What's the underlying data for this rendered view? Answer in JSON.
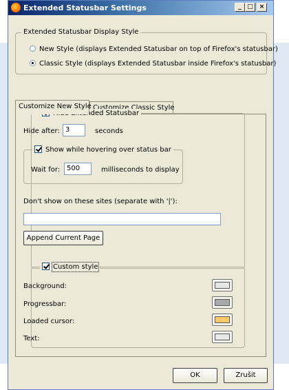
{
  "window": {
    "title": "Extended Statusbar Settings",
    "minimize": "_",
    "maximize": "□",
    "close": "×"
  },
  "display_style": {
    "legend": "Extended Statusbar Display Style",
    "new_style": {
      "label": "New Style (displays Extended Statusbar on top of Firefox's statusbar)",
      "selected": false
    },
    "classic_style": {
      "label": "Classic Style (displays Extended Statusbar inside Firefox's statusbar)",
      "selected": true
    }
  },
  "tabs": [
    {
      "label": "Customize New Style",
      "active": true
    },
    {
      "label": "Customize Classic Style",
      "active": false
    }
  ],
  "hide_group": {
    "checkbox_label": "Hide Extended Statusbar",
    "checked": true,
    "hide_after_label": "Hide after:",
    "hide_after_value": "3",
    "hide_after_unit": "seconds",
    "hover_checkbox_label": "Show while hovering over status bar",
    "hover_checked": true,
    "wait_for_label": "Wait for:",
    "wait_for_value": "500",
    "wait_for_unit": "milliseconds to display",
    "sites_label": "Don't show on these sites (separate with '|'):",
    "sites_value": "",
    "append_button": "Append Current Page"
  },
  "custom_group": {
    "checkbox_label": "Custom style",
    "checked": true,
    "rows": [
      {
        "label": "Background:",
        "color": "#e6e6e6"
      },
      {
        "label": "Progressbar:",
        "color": "#a7a9ab"
      },
      {
        "label": "Loaded cursor:",
        "color": "#ffc966"
      },
      {
        "label": "Text:",
        "color": "#e8e8e8"
      }
    ]
  },
  "footer": {
    "ok": "OK",
    "cancel": "Zrušit"
  }
}
